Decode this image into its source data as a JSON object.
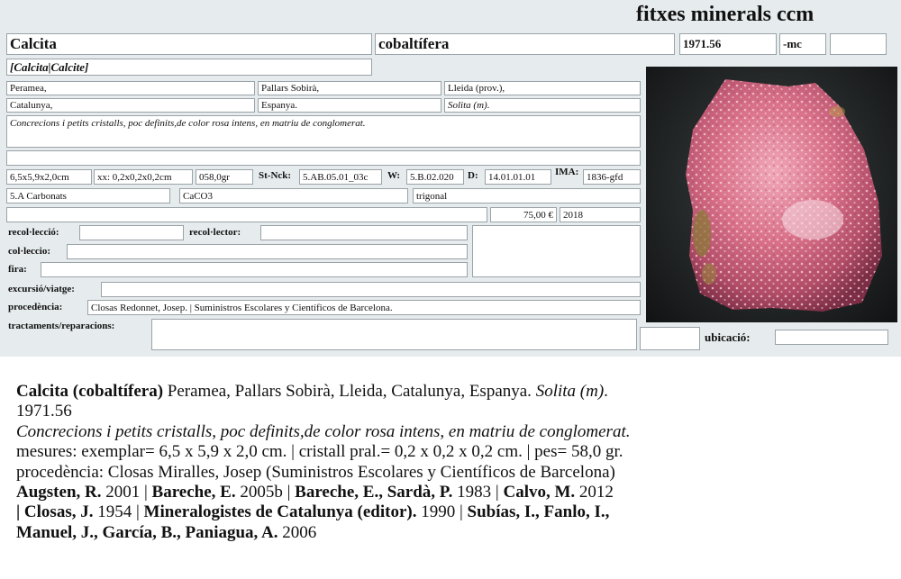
{
  "header": {
    "title": "fitxes minerals ccm"
  },
  "card": {
    "name": "Calcita",
    "variety": "cobaltífera",
    "number": "1971.56",
    "suffix": "-mc",
    "extra": "",
    "synonyms": "[Calcita|Calcite]",
    "locality": "Peramea,",
    "district": "Pallars Sobirà,",
    "province": "Lleida (prov.),",
    "region": "Catalunya,",
    "country": "Espanya.",
    "mine": "Solita (m).",
    "description": "Concrecions i petits cristalls, poc definits,de color rosa intens, en matriu de conglomerat.",
    "size": "6,5x5,9x2,0cm",
    "crystal_size": "xx: 0,2x0,2x0,2cm",
    "weight": "058,0gr",
    "stnck_label": "St-Nck:",
    "stnck_value": "5.AB.05.01_03c",
    "w_label": "W:",
    "w_value": "5.B.02.020",
    "d_label": "D:",
    "d_value": "14.01.01.01",
    "ima_label": "IMA:",
    "ima_value": "1836-gfd",
    "class": "5.A Carbonats",
    "formula": "CaCO3",
    "system": "trigonal",
    "price": "75,00 €",
    "year": "2018",
    "recol_leccio_label": "recol·lecció:",
    "recol_lector_label": "recol·lector:",
    "col_leccio_label": "col·leccio:",
    "fira_label": "fira:",
    "excursio_label": "excursió/viatge:",
    "procedencia_label": "procedència:",
    "procedencia_value": "Closas Redonnet, Josep. | Suministros Escolares y Científicos de Barcelona.",
    "tractaments_label": "tractaments/reparacions:",
    "ubicacio_label": "ubicació:"
  },
  "photo": {
    "subject": "pink cobaltoan calcite specimen",
    "bg_color": "#222526",
    "mineral_color": "#d9728a"
  },
  "summary": {
    "name": "Calcita (cobaltífera)",
    "location": " Peramea, Pallars Sobirà, Lleida, Catalunya, Espanya. ",
    "mine": "Solita (m)",
    "mine_end": ".",
    "number": "1971.56",
    "description": "Concrecions i petits cristalls, poc definits,de color rosa intens, en matriu de conglomerat.",
    "measures": "mesures: exemplar= 6,5 x 5,9 x 2,0 cm. | cristall pral.= 0,2 x 0,2 x 0,2 cm. | pes= 58,0 gr.",
    "provenance": "procedència: Closas Miralles, Josep (Suministros Escolares y Científicos de Barcelona)",
    "refs": [
      {
        "author": "Augsten, R.",
        "year": " 2001 | "
      },
      {
        "author": "Bareche, E.",
        "year": " 2005b | "
      },
      {
        "author": "Bareche, E., Sardà, P.",
        "year": " 1983 | "
      },
      {
        "author": "Calvo, M.",
        "year": " 2012"
      },
      {
        "author": "| Closas, J.",
        "year": " 1954 | "
      },
      {
        "author": "Mineralogistes de Catalunya (editor).",
        "year": " 1990 | "
      },
      {
        "author": "Subías, I., Fanlo, I.,",
        "year": ""
      },
      {
        "author": "Manuel, J., García, B., Paniagua, A.",
        "year": " 2006"
      }
    ]
  }
}
